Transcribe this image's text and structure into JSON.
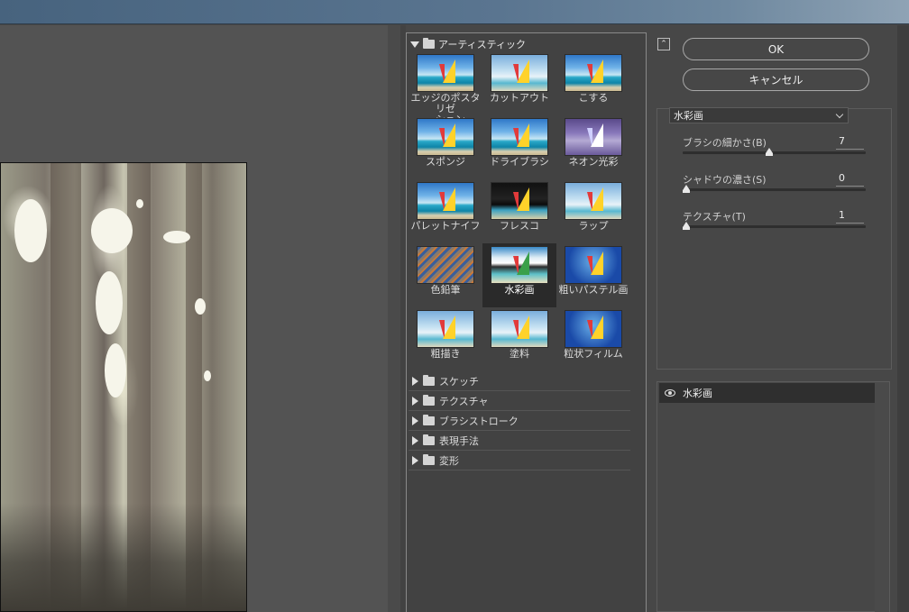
{
  "gallery": {
    "category_open": "アーティスティック",
    "filters": [
      {
        "label": "エッジのポスタリゼ\nーション",
        "variant": "v-std",
        "selected": false
      },
      {
        "label": "カットアウト",
        "variant": "v-pale",
        "selected": false
      },
      {
        "label": "こする",
        "variant": "v-std",
        "selected": false
      },
      {
        "label": "スポンジ",
        "variant": "v-std",
        "selected": false
      },
      {
        "label": "ドライブラシ",
        "variant": "v-std",
        "selected": false
      },
      {
        "label": "ネオン光彩",
        "variant": "v-neon",
        "selected": false
      },
      {
        "label": "パレットナイフ",
        "variant": "v-std",
        "selected": false
      },
      {
        "label": "フレスコ",
        "variant": "v-dark",
        "selected": false
      },
      {
        "label": "ラップ",
        "variant": "v-pale",
        "selected": false
      },
      {
        "label": "色鉛筆",
        "variant": "v-pencil",
        "selected": false
      },
      {
        "label": "水彩画",
        "variant": "v-water",
        "selected": true
      },
      {
        "label": "粗いパステル画",
        "variant": "v-grain",
        "selected": false
      },
      {
        "label": "粗描き",
        "variant": "v-pale",
        "selected": false
      },
      {
        "label": "塗料",
        "variant": "v-pale",
        "selected": false
      },
      {
        "label": "粒状フィルム",
        "variant": "v-grain",
        "selected": false
      }
    ],
    "categories": [
      "スケッチ",
      "テクスチャ",
      "ブラシストローク",
      "表現手法",
      "変形"
    ]
  },
  "buttons": {
    "ok": "OK",
    "cancel": "キャンセル"
  },
  "settings": {
    "filter_name": "水彩画",
    "params": [
      {
        "label": "ブラシの細かさ(B)",
        "value": "7",
        "fraction": 0.46
      },
      {
        "label": "シャドウの濃さ(S)",
        "value": "0",
        "fraction": 0.0
      },
      {
        "label": "テクスチャ(T)",
        "value": "1",
        "fraction": 0.0
      }
    ]
  },
  "layers": {
    "items": [
      {
        "name": "水彩画",
        "visible": true
      }
    ]
  }
}
